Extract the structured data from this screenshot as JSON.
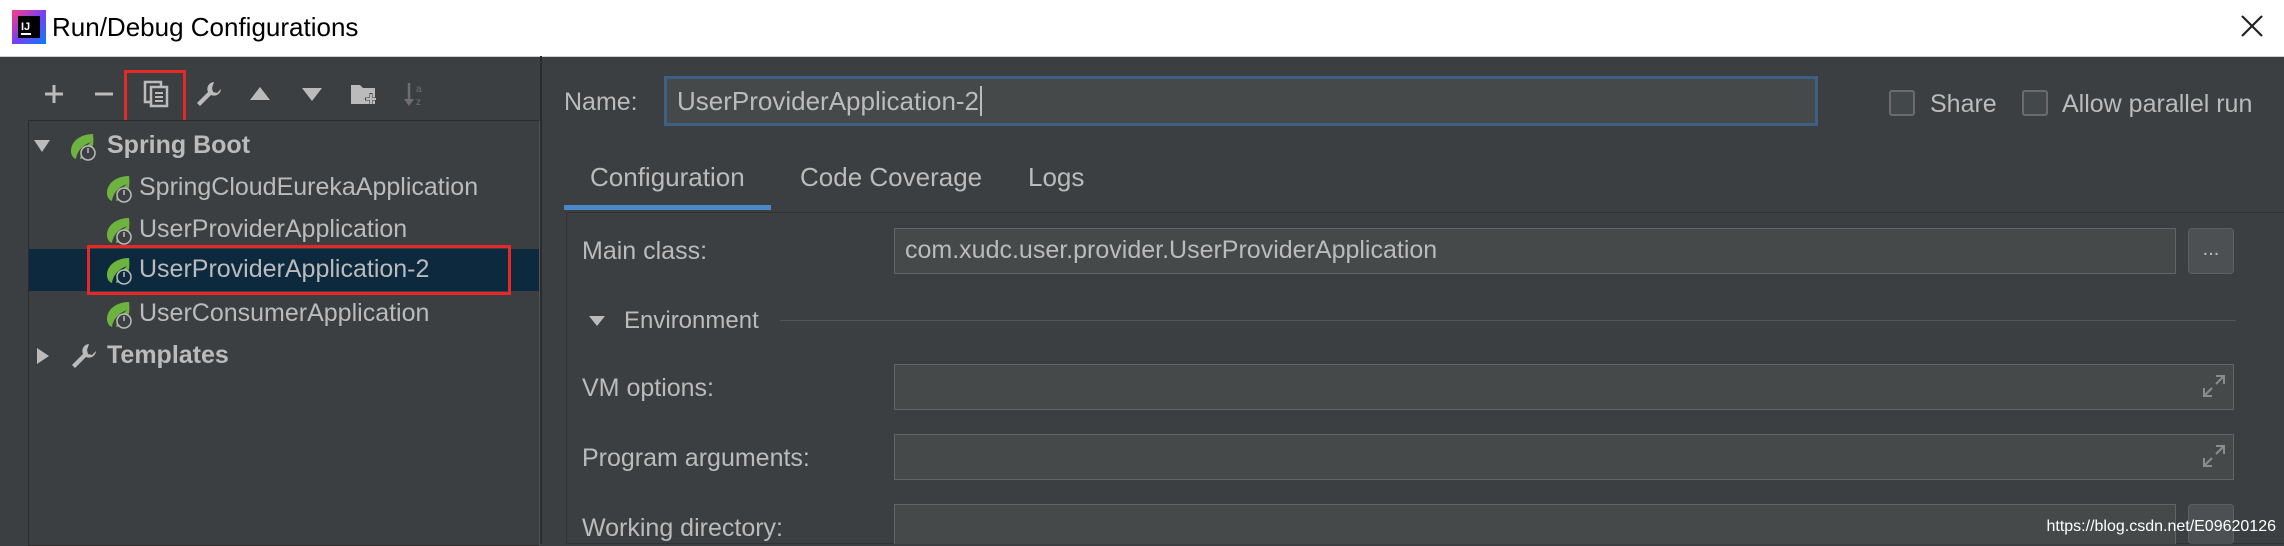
{
  "window": {
    "title": "Run/Debug Configurations",
    "close_icon": "close-icon",
    "app_icon": "intellij-logo-icon"
  },
  "toolbar": {
    "icons": [
      "add-icon",
      "remove-icon",
      "copy-icon",
      "wrench-icon",
      "move-up-icon",
      "move-down-icon",
      "new-folder-icon",
      "sort-icon"
    ]
  },
  "tree": {
    "spring_boot": "Spring Boot",
    "items": [
      "SpringCloudEurekaApplication",
      "UserProviderApplication",
      "UserProviderApplication-2",
      "UserConsumerApplication"
    ],
    "templates": "Templates",
    "selected_index": 2
  },
  "header": {
    "name_label": "Name:",
    "name_value": "UserProviderApplication-2",
    "share_label": "Share",
    "parallel_label": "Allow parallel run"
  },
  "tabs": [
    "Configuration",
    "Code Coverage",
    "Logs"
  ],
  "config": {
    "main_class_label": "Main class:",
    "main_class_value": "com.xudc.user.provider.UserProviderApplication",
    "browse_label": "...",
    "environment_label": "Environment",
    "vm_options_label": "VM options:",
    "program_args_label": "Program arguments:",
    "working_dir_label": "Working directory:"
  },
  "watermark": "https://blog.csdn.net/E09620126",
  "colors": {
    "background": "#3c3f41",
    "selection": "#0d293e",
    "accent": "#4a88c7",
    "highlight_box": "#e52828",
    "spring_green": "#6db33f"
  }
}
